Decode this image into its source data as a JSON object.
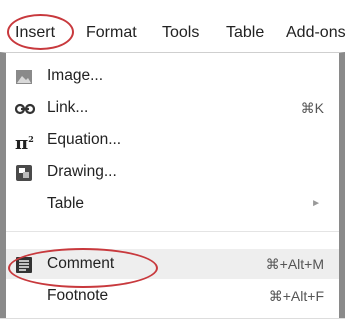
{
  "menubar": {
    "insert": "Insert",
    "format": "Format",
    "tools": "Tools",
    "table": "Table",
    "addons": "Add-ons"
  },
  "menu": {
    "items": [
      {
        "label": "Image...",
        "icon": "image-icon",
        "shortcut": ""
      },
      {
        "label": "Link...",
        "icon": "link-icon",
        "shortcut": "⌘K"
      },
      {
        "label": "Equation...",
        "icon": "pi-icon",
        "shortcut": ""
      },
      {
        "label": "Drawing...",
        "icon": "drawing-icon",
        "shortcut": ""
      },
      {
        "label": "Table",
        "icon": "",
        "shortcut": ""
      },
      {
        "label": "Comment",
        "icon": "comment-icon",
        "shortcut": "⌘+Alt+M"
      },
      {
        "label": "Footnote",
        "icon": "",
        "shortcut": "⌘+Alt+F"
      }
    ],
    "submenu_arrow": "►"
  },
  "colors": {
    "highlight_circle": "#c8393d",
    "hover_bg": "#eeeeee",
    "icon_gray": "#8a8a8a"
  }
}
